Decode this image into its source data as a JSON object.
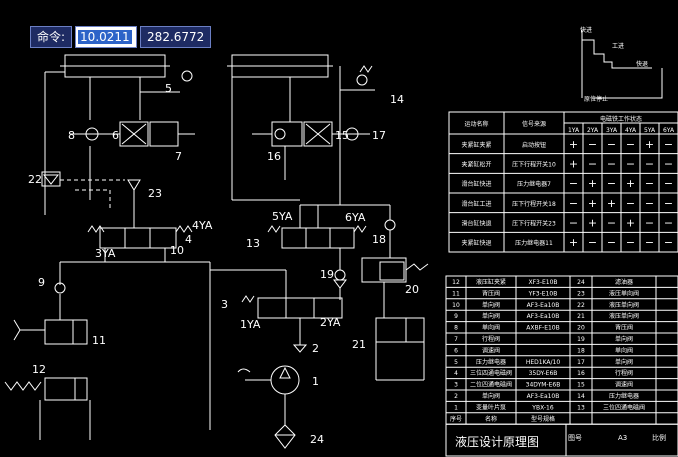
{
  "command_bar": {
    "label": "命令:",
    "x_value": "10.0211",
    "y_value": "282.6772"
  },
  "schematic": {
    "component_numbers": [
      "5",
      "6",
      "7",
      "8",
      "14",
      "15",
      "16",
      "17",
      "22",
      "23",
      "4",
      "10",
      "13",
      "18",
      "9",
      "11",
      "12",
      "3",
      "19",
      "20",
      "21",
      "2",
      "1",
      "24"
    ],
    "solenoid_labels": [
      "4YA",
      "5YA",
      "6YA",
      "3YA",
      "1YA",
      "2YA"
    ],
    "mini_diagram_labels": [
      "快进",
      "工进",
      "快退",
      "原位停止"
    ]
  },
  "action_table": {
    "headers": {
      "action": "运动名称",
      "signal": "信号来源",
      "solenoid": "电磁铁工作状态"
    },
    "solenoids": [
      "1YA",
      "2YA",
      "3YA",
      "4YA",
      "5YA",
      "6YA"
    ],
    "rows": [
      {
        "action": "夹紧缸夹紧",
        "signal": "启动按钮",
        "states": [
          "+",
          "−",
          "−",
          "−",
          "+",
          "−"
        ]
      },
      {
        "action": "夹紧缸松开",
        "signal": "压下行程开关10",
        "states": [
          "+",
          "−",
          "−",
          "−",
          "−",
          "−"
        ]
      },
      {
        "action": "滑台缸快进",
        "signal": "压力继电器7",
        "states": [
          "−",
          "+",
          "−",
          "+",
          "−",
          "−"
        ]
      },
      {
        "action": "滑台缸工进",
        "signal": "压下行程开关18",
        "states": [
          "−",
          "+",
          "+",
          "−",
          "−",
          "−"
        ]
      },
      {
        "action": "滑台缸快退",
        "signal": "压下行程开关23",
        "states": [
          "−",
          "+",
          "−",
          "+",
          "−",
          "−"
        ]
      },
      {
        "action": "夹紧缸快退",
        "signal": "压力继电器11",
        "states": [
          "+",
          "−",
          "−",
          "−",
          "−",
          "−"
        ]
      }
    ]
  },
  "parts_list": {
    "left": [
      {
        "no": "12",
        "name": "液压缸夹紧",
        "model": "XF3-E10B"
      },
      {
        "no": "11",
        "name": "背压阀",
        "model": "YF3-E10B"
      },
      {
        "no": "10",
        "name": "单向阀",
        "model": "AF3-Ea10B"
      },
      {
        "no": "9",
        "name": "单向阀",
        "model": "AF3-Ea10B"
      },
      {
        "no": "8",
        "name": "单向阀",
        "model": "AXBF-E10B"
      },
      {
        "no": "7",
        "name": "行程阀",
        "model": ""
      },
      {
        "no": "6",
        "name": "调速阀",
        "model": ""
      },
      {
        "no": "5",
        "name": "压力继电器",
        "model": "HED1KA/10"
      },
      {
        "no": "4",
        "name": "三位四通电磁阀",
        "model": "35DY-E6B"
      },
      {
        "no": "3",
        "name": "二位四通电磁阀",
        "model": "34DYM-E6B"
      },
      {
        "no": "2",
        "name": "单向阀",
        "model": "AF3-Ea10B"
      },
      {
        "no": "1",
        "name": "变量叶片泵",
        "model": "YBX-16"
      }
    ],
    "right": [
      {
        "no": "24",
        "name": "滤油器",
        "model": ""
      },
      {
        "no": "23",
        "name": "液压单向阀",
        "model": ""
      },
      {
        "no": "22",
        "name": "液压单向阀",
        "model": ""
      },
      {
        "no": "21",
        "name": "液压单向阀",
        "model": ""
      },
      {
        "no": "20",
        "name": "背压阀",
        "model": ""
      },
      {
        "no": "19",
        "name": "单向阀",
        "model": ""
      },
      {
        "no": "18",
        "name": "单向阀",
        "model": ""
      },
      {
        "no": "17",
        "name": "单向阀",
        "model": ""
      },
      {
        "no": "16",
        "name": "行程阀",
        "model": ""
      },
      {
        "no": "15",
        "name": "调速阀",
        "model": ""
      },
      {
        "no": "14",
        "name": "压力继电器",
        "model": ""
      },
      {
        "no": "13",
        "name": "三位四通电磁阀",
        "model": ""
      }
    ],
    "footer_cols": [
      "序号",
      "名称",
      "型号规格"
    ]
  },
  "title_block": {
    "title": "液压设计原理图",
    "figure_no_label": "图号",
    "figure_no": "A3",
    "scale_label": "比例"
  }
}
